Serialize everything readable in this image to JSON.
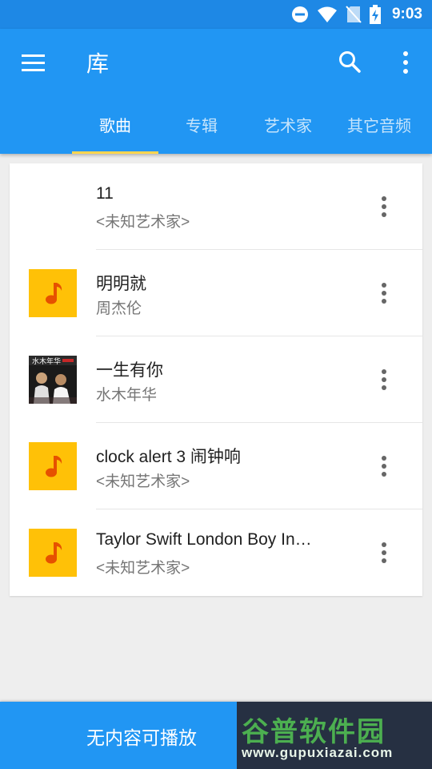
{
  "status_bar": {
    "time": "9:03"
  },
  "app_bar": {
    "title": "库"
  },
  "tabs": [
    {
      "label": "歌曲",
      "active": true
    },
    {
      "label": "专辑",
      "active": false
    },
    {
      "label": "艺术家",
      "active": false
    },
    {
      "label": "其它音频",
      "active": false
    }
  ],
  "songs": [
    {
      "title": "11",
      "artist": "<未知艺术家>",
      "thumb": "none"
    },
    {
      "title": "明明就",
      "artist": "周杰伦",
      "thumb": "music-note-icon"
    },
    {
      "title": "一生有你",
      "artist": "水木年华",
      "thumb": "album-cover"
    },
    {
      "title": "clock alert 3 闹钟响",
      "artist": "<未知艺术家>",
      "thumb": "music-note-icon"
    },
    {
      "title": "Taylor Swift London Boy In…",
      "artist": "<未知艺术家>",
      "thumb": "music-note-icon"
    }
  ],
  "album_cover_text": "水木年华",
  "bottom_bar": {
    "message": "无内容可播放"
  },
  "watermark": {
    "logo": "谷普软件园",
    "url": "www.gupuxiazai.com"
  },
  "colors": {
    "status_bar": "#1e88e5",
    "primary": "#2196f3",
    "tab_indicator": "#ffd54f",
    "note_tile": "#ffc107",
    "note_glyph": "#e65100"
  }
}
